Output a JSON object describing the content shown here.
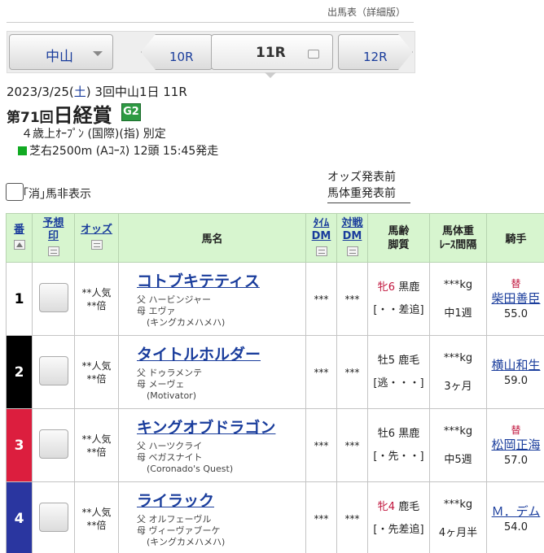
{
  "header": {
    "detail_link": "出馬表（詳細版）"
  },
  "nav": {
    "venue": "中山",
    "prev_race": "10R",
    "current_race": "11R",
    "next_race": "12R"
  },
  "race": {
    "date_info": "2023/3/25(",
    "weekday": "土",
    "meet_info": ") 3回中山1日 11R",
    "edition": "第71回",
    "name": "日経賞",
    "grade": "G2",
    "conditions": "４歳上ｵｰﾌﾟﾝ (国際)(指) 別定",
    "course": "芝右2500m (Aｺｰｽ) 12頭 15:45発走"
  },
  "options": {
    "hide_scratched_label": "｢消｣馬非表示"
  },
  "notes": {
    "odds": "オッズ発表前",
    "weight": "馬体重発表前"
  },
  "table": {
    "headers": {
      "number": "番",
      "prediction_1": "予想",
      "prediction_2": "印",
      "odds": "オッズ",
      "horse": "馬名",
      "time_dm_1": "ﾀｲﾑ",
      "time_dm_2": "DM",
      "match_dm_1": "対戦",
      "match_dm_2": "DM",
      "age_1": "馬齢",
      "age_2": "脚質",
      "weight_1": "馬体重",
      "weight_2": "ﾚｰｽ間隔",
      "jockey": "騎手"
    },
    "rows": [
      {
        "number": "1",
        "odds_pop": "**人気",
        "odds_val": "**倍",
        "name": "コトブキテティス",
        "sire": "父 ハービンジャー",
        "dam": "母 エヴァ",
        "dam_sire": "(キングカメハメハ)",
        "time_dm": "***",
        "match_dm": "***",
        "sex": "牝6",
        "coat": "黒鹿",
        "style": "[・・差追]",
        "weight": "***kg",
        "interval": "中1週",
        "change": "替",
        "jockey": "柴田善臣",
        "carried": "55.0"
      },
      {
        "number": "2",
        "odds_pop": "**人気",
        "odds_val": "**倍",
        "name": "タイトルホルダー",
        "sire": "父 ドゥラメンテ",
        "dam": "母 メーヴェ",
        "dam_sire": "(Motivator)",
        "time_dm": "***",
        "match_dm": "***",
        "sex": "牡5",
        "coat": "鹿毛",
        "style": "[逃・・・]",
        "weight": "***kg",
        "interval": "3ヶ月",
        "change": "",
        "jockey": "横山和生",
        "carried": "59.0"
      },
      {
        "number": "3",
        "odds_pop": "**人気",
        "odds_val": "**倍",
        "name": "キングオブドラゴン",
        "sire": "父 ハーツクライ",
        "dam": "母 ベガスナイト",
        "dam_sire": "(Coronado's Quest)",
        "time_dm": "***",
        "match_dm": "***",
        "sex": "牡6",
        "coat": "黒鹿",
        "style": "[・先・・]",
        "weight": "***kg",
        "interval": "中5週",
        "change": "替",
        "jockey": "松岡正海",
        "carried": "57.0"
      },
      {
        "number": "4",
        "odds_pop": "**人気",
        "odds_val": "**倍",
        "name": "ライラック",
        "sire": "父 オルフェーヴル",
        "dam": "母 ヴィーヴァブーケ",
        "dam_sire": "(キングカメハメハ)",
        "time_dm": "***",
        "match_dm": "***",
        "sex": "牝4",
        "coat": "鹿毛",
        "style": "[・先差追]",
        "weight": "***kg",
        "interval": "4ヶ月半",
        "change": "",
        "jockey": "Ｍ．デム",
        "carried": "54.0"
      }
    ]
  }
}
